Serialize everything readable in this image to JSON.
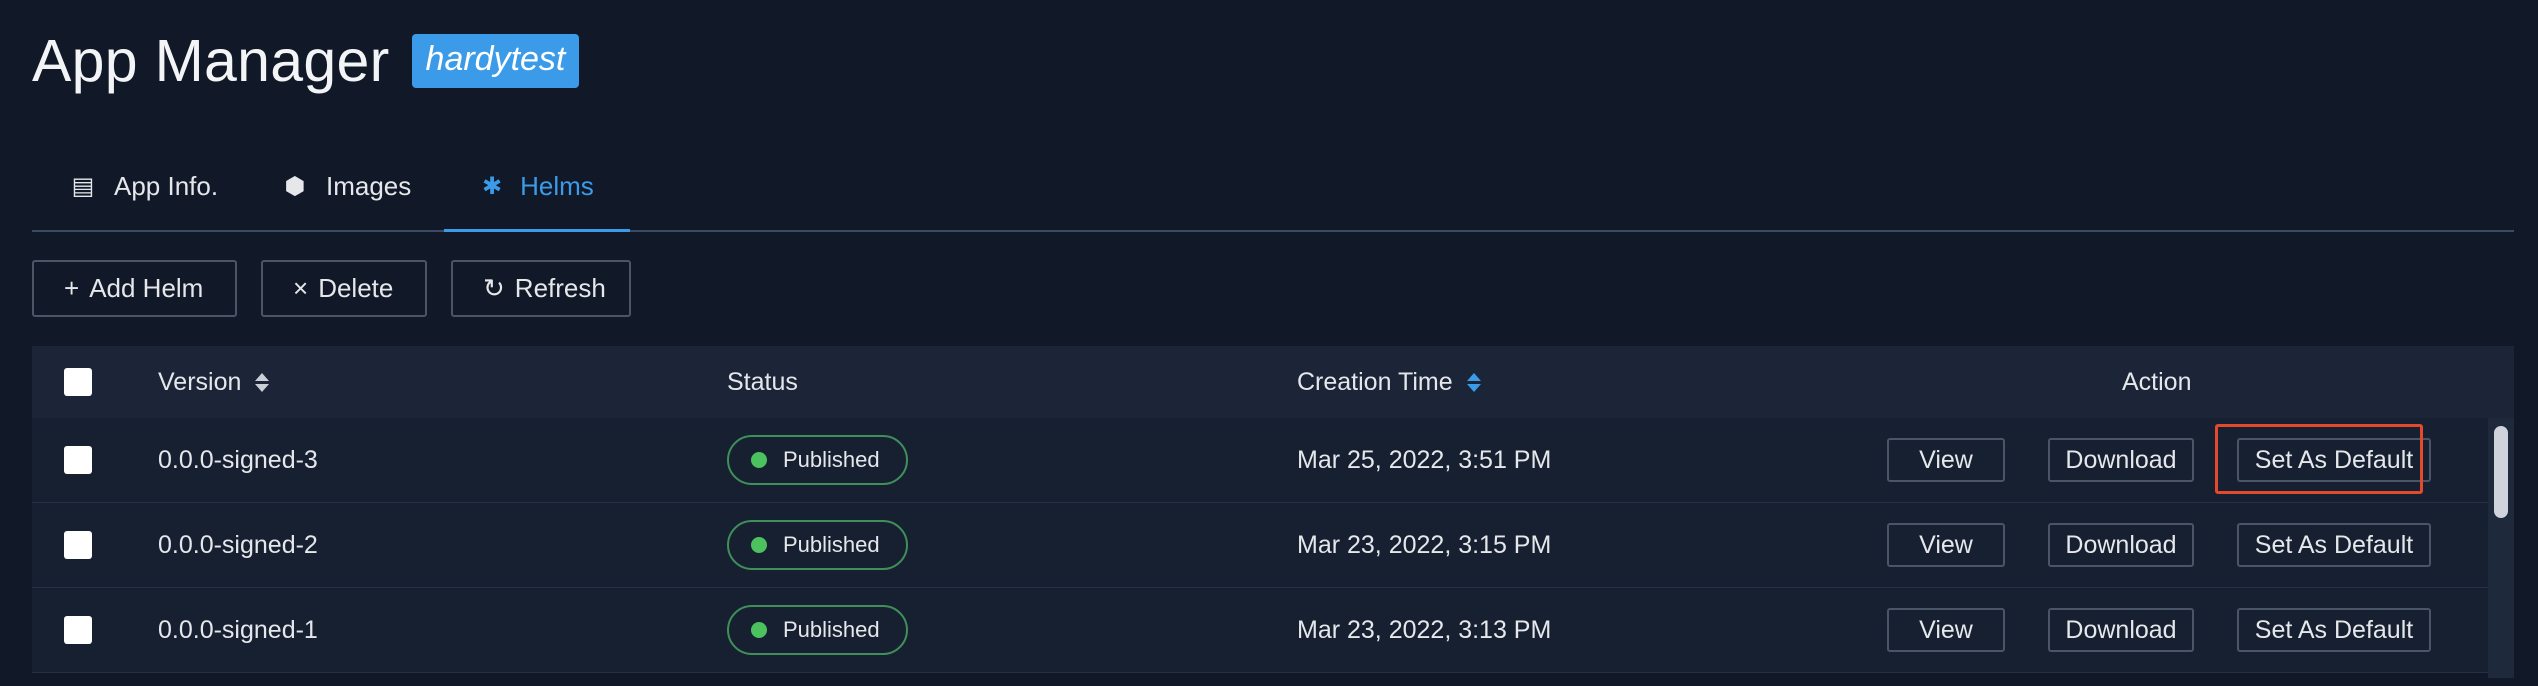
{
  "header": {
    "title": "App Manager",
    "badge": "hardytest"
  },
  "tabs": [
    {
      "label": "App Info.",
      "icon": "document-icon"
    },
    {
      "label": "Images",
      "icon": "cube-icon"
    },
    {
      "label": "Helms",
      "icon": "asterisk-icon",
      "active": true
    }
  ],
  "toolbar": {
    "add_label": "Add Helm",
    "delete_label": "Delete",
    "refresh_label": "Refresh"
  },
  "table": {
    "columns": {
      "version": "Version",
      "status": "Status",
      "creation_time": "Creation Time",
      "action": "Action"
    },
    "rows": [
      {
        "version": "0.0.0-signed-3",
        "status": "Published",
        "time": "Mar 25, 2022, 3:51 PM",
        "view": "View",
        "download": "Download",
        "default": "Set As Default"
      },
      {
        "version": "0.0.0-signed-2",
        "status": "Published",
        "time": "Mar 23, 2022, 3:15 PM",
        "view": "View",
        "download": "Download",
        "default": "Set As Default"
      },
      {
        "version": "0.0.0-signed-1",
        "status": "Published",
        "time": "Mar 23, 2022, 3:13 PM",
        "view": "View",
        "download": "Download",
        "default": "Set As Default"
      }
    ]
  },
  "colors": {
    "accent": "#3b9be8",
    "published": "#4cc25f",
    "highlight": "#e24a2b",
    "background": "#111827"
  }
}
